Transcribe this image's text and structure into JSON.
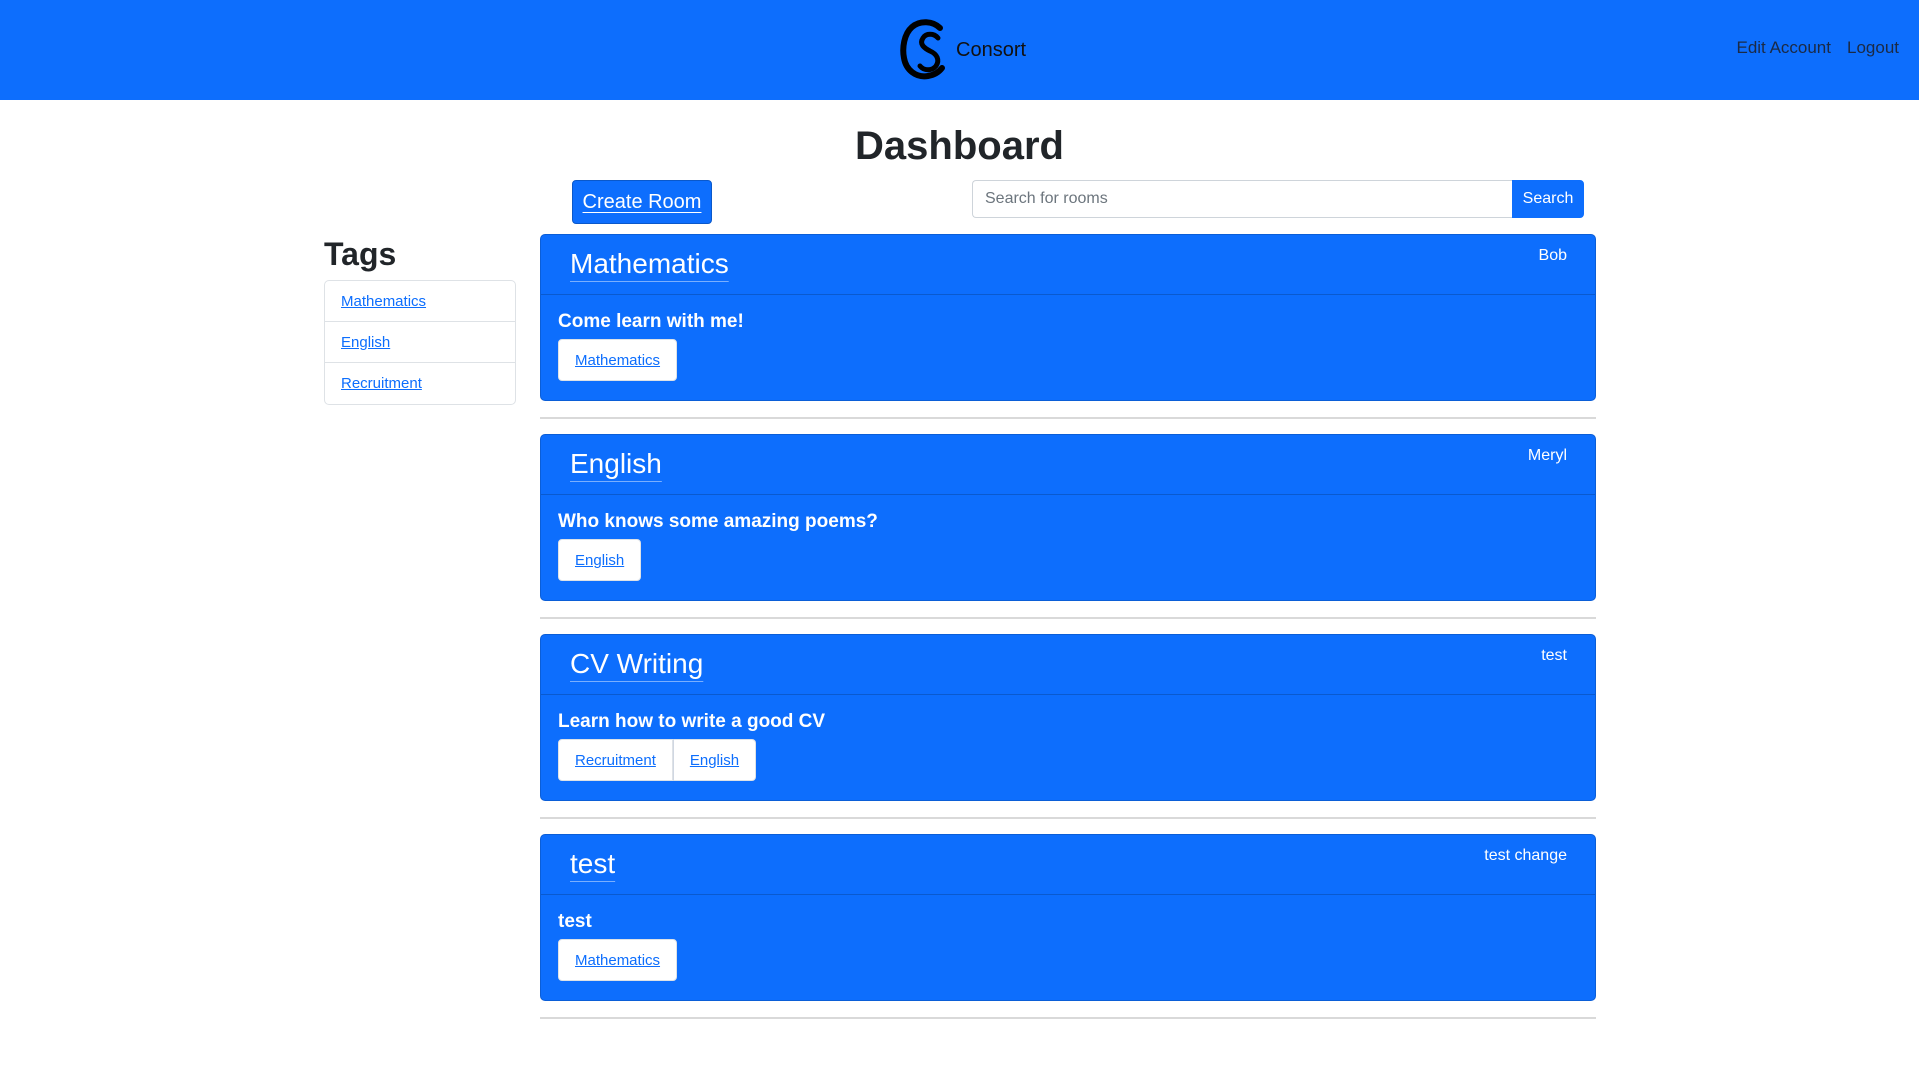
{
  "nav": {
    "brand": "Consort",
    "logo_icon": "consort-cs-logo-icon",
    "links": [
      "Edit Account",
      "Logout"
    ]
  },
  "page": {
    "title": "Dashboard"
  },
  "toolbar": {
    "create_label": "Create Room",
    "search_placeholder": "Search for rooms",
    "search_value": "",
    "search_label": "Search"
  },
  "tags": {
    "title": "Tags",
    "items": [
      "Mathematics",
      "English",
      "Recruitment"
    ]
  },
  "rooms": [
    {
      "title": "Mathematics",
      "owner": "Bob",
      "description": "Come learn with me!",
      "tags": [
        "Mathematics"
      ]
    },
    {
      "title": "English",
      "owner": "Meryl",
      "description": "Who knows some amazing poems?",
      "tags": [
        "English"
      ]
    },
    {
      "title": "CV Writing",
      "owner": "test",
      "description": "Learn how to write a good CV",
      "tags": [
        "Recruitment",
        "English"
      ]
    },
    {
      "title": "test",
      "owner": "test change",
      "description": "test",
      "tags": [
        "Mathematics"
      ]
    }
  ],
  "colors": {
    "primary": "#0d6efd",
    "card_border": "#0b5ed7",
    "divider": "#d9d9d9",
    "page_background": "#ffffff"
  }
}
